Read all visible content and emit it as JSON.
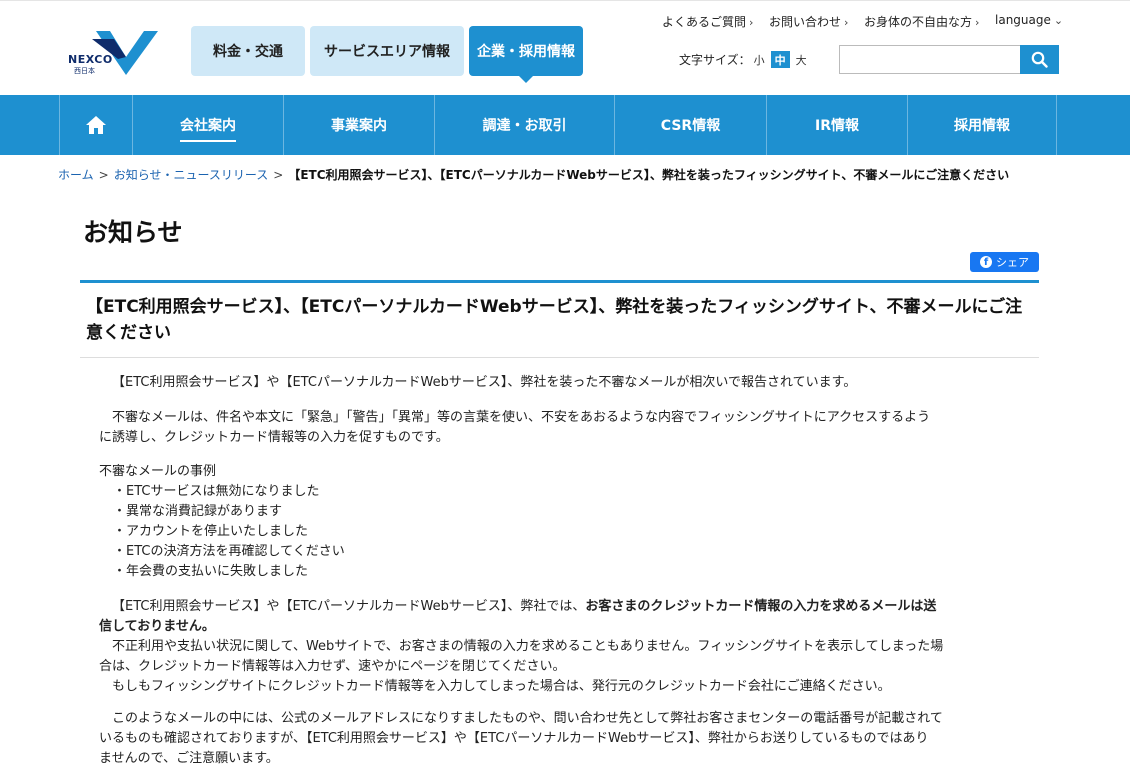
{
  "logo": {
    "word": "NEXCO",
    "sub": "西日本"
  },
  "global_tabs": [
    {
      "label": "料金・交通"
    },
    {
      "label": "サービスエリア情報"
    },
    {
      "label": "企業・採用情報"
    }
  ],
  "utility_links": [
    {
      "label": "よくあるご質問"
    },
    {
      "label": "お問い合わせ"
    },
    {
      "label": "お身体の不自由な方"
    },
    {
      "label": "language"
    }
  ],
  "font_size": {
    "label": "文字サイズ：",
    "small": "小",
    "medium": "中",
    "large": "大"
  },
  "search": {
    "placeholder": ""
  },
  "main_nav": [
    {
      "label": "会社案内"
    },
    {
      "label": "事業案内"
    },
    {
      "label": "調達・お取引"
    },
    {
      "label": "CSR情報"
    },
    {
      "label": "IR情報"
    },
    {
      "label": "採用情報"
    }
  ],
  "breadcrumb": {
    "home": "ホーム",
    "news": "お知らせ・ニュースリリース",
    "separator": ">",
    "current": "【ETC利用照会サービス】、【ETCパーソナルカードWebサービス】、弊社を装ったフィッシングサイト、不審メールにご注意ください"
  },
  "page_title": "お知らせ",
  "share": {
    "label": "シェア"
  },
  "article": {
    "title": "【ETC利用照会サービス】、【ETCパーソナルカードWebサービス】、弊社を装ったフィッシングサイト、不審メールにご注意ください",
    "p1": "【ETC利用照会サービス】や【ETCパーソナルカードWebサービス】、弊社を装った不審なメールが相次いで報告されています。",
    "p2_line1": "不審なメールは、件名や本文に「緊急」「警告」「異常」等の言葉を使い、不安をあおるような内容でフィッシングサイトにアクセスするよう",
    "p2_line2": "に誘導し、クレジットカード情報等の入力を促すものです。",
    "examples_heading": "不審なメールの事例",
    "examples": [
      "・ETCサービスは無効になりました",
      "・異常な消費記録があります",
      "・アカウントを停止いたしました",
      "・ETCの決済方法を再確認してください",
      "・年会費の支払いに失敗しました"
    ],
    "p3_normal": "【ETC利用照会サービス】や【ETCパーソナルカードWebサービス】、弊社では、",
    "p3_bold_line1": "お客さまのクレジットカード情報の入力を求めるメールは送",
    "p3_bold_line2": "信しておりません。",
    "p4_line1": "不正利用や支払い状況に関して、Webサイトで、お客さまの情報の入力を求めることもありません。フィッシングサイトを表示してしまった場",
    "p4_line2": "合は、クレジットカード情報等は入力せず、速やかにページを閉じてください。",
    "p5": "もしもフィッシングサイトにクレジットカード情報等を入力してしまった場合は、発行元のクレジットカード会社にご連絡ください。",
    "p6_line1": "このようなメールの中には、公式のメールアドレスになりすましたものや、問い合わせ先として弊社お客さまセンターの電話番号が記載されて",
    "p6_line2": "いるものも確認されておりますが、【ETC利用照会サービス】や【ETCパーソナルカードWebサービス】、弊社からお送りしているものではあり",
    "p6_line3": "ませんので、ご注意願います。"
  },
  "colors": {
    "brand_blue": "#1e90d0",
    "tab_light": "#cfe8f7",
    "facebook": "#1877f2",
    "link": "#1b63b0"
  }
}
